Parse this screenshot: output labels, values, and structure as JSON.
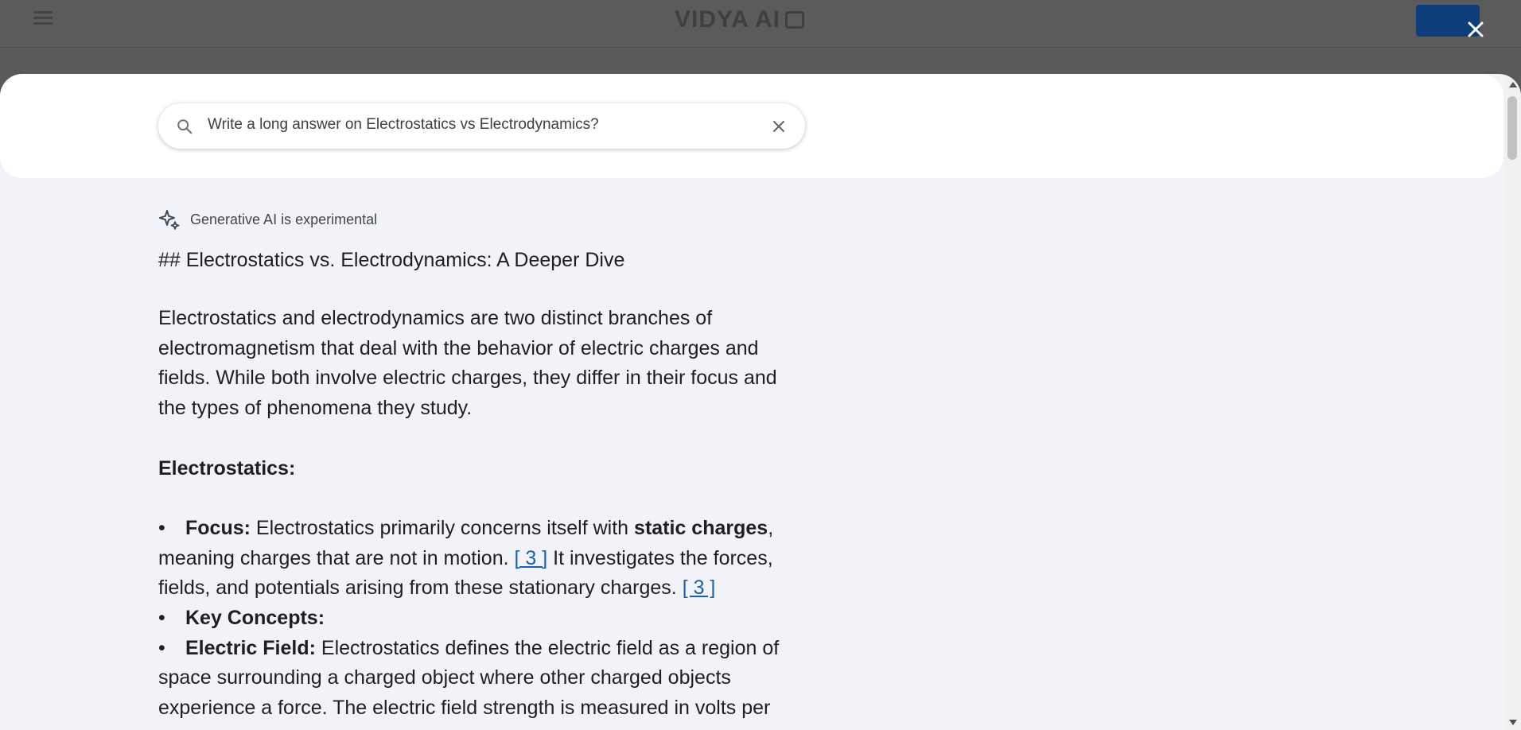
{
  "background_app": {
    "logo_text": "VIDYA AI"
  },
  "search": {
    "query": "Write a long answer on Electrostatics vs Electrodynamics?"
  },
  "answer": {
    "badge": "Generative AI is experimental",
    "heading": "## Electrostatics vs. Electrodynamics: A Deeper Dive",
    "intro": "Electrostatics and electrodynamics are two distinct branches of electromagnetism that deal with the behavior of electric charges and fields. While both involve electric charges, they differ in their focus and the types of phenomena they study.",
    "section_title": "Electrostatics:",
    "bullet1": {
      "label": "Focus:",
      "text_a": " Electrostatics primarily concerns itself with ",
      "bold": "static charges",
      "text_b": ", meaning charges that are not in motion. ",
      "cite1": "[ 3 ]",
      "text_c": " It investigates the forces, fields, and potentials arising from these stationary charges. ",
      "cite2": "[ 3 ]"
    },
    "bullet2": {
      "label": "Key Concepts:"
    },
    "bullet3": {
      "label": "Electric Field:",
      "text": " Electrostatics defines the electric field as a region of space surrounding a charged object where other charged objects experience a force. The electric field strength is measured in volts per"
    }
  },
  "colors": {
    "accent_link": "#1a5fb4",
    "modal_bg": "#f2f3f8",
    "overlay": "#5a5a5a"
  }
}
